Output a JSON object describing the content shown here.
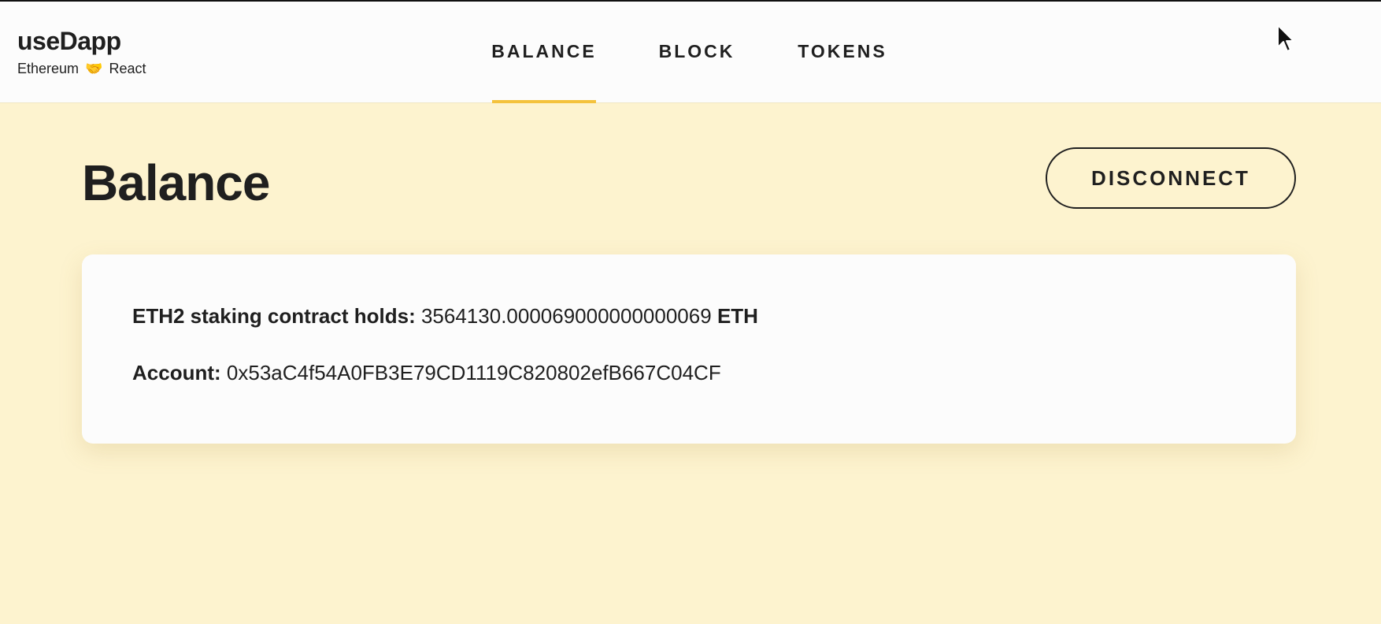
{
  "app": {
    "title": "useDapp",
    "subtitle_left": "Ethereum",
    "subtitle_icon": "handshake-icon",
    "subtitle_glyph": "🤝",
    "subtitle_right": "React"
  },
  "nav": {
    "tabs": [
      {
        "label": "BALANCE",
        "active": true
      },
      {
        "label": "BLOCK",
        "active": false
      },
      {
        "label": "TOKENS",
        "active": false
      }
    ],
    "active_color": "#f4c23c"
  },
  "page": {
    "title": "Balance",
    "disconnect_label": "DISCONNECT",
    "background_color": "#fdf3cf"
  },
  "balance_card": {
    "staking_label": "ETH2 staking contract holds:",
    "staking_value": "3564130.000069000000000069",
    "staking_unit": "ETH",
    "account_label": "Account:",
    "account_value": "0x53aC4f54A0FB3E79CD1119C820802efB667C04CF"
  },
  "cursor": {
    "icon": "mouse-pointer-icon"
  }
}
